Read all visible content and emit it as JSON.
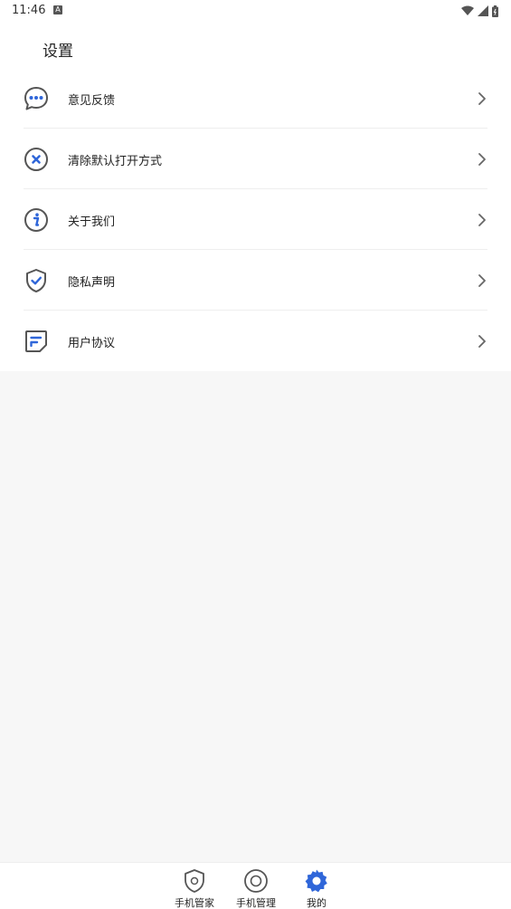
{
  "status_bar": {
    "time": "11:46",
    "indicator": "A"
  },
  "header": {
    "title": "设置"
  },
  "menu": {
    "items": [
      {
        "label": "意见反馈",
        "icon": "chat-bubble-icon"
      },
      {
        "label": "清除默认打开方式",
        "icon": "clear-x-icon"
      },
      {
        "label": "关于我们",
        "icon": "info-icon"
      },
      {
        "label": "隐私声明",
        "icon": "shield-check-icon"
      },
      {
        "label": "用户协议",
        "icon": "document-icon"
      }
    ]
  },
  "bottom_nav": {
    "tabs": [
      {
        "label": "手机管家",
        "icon": "shield-icon",
        "active": false
      },
      {
        "label": "手机管理",
        "icon": "circle-icon",
        "active": false
      },
      {
        "label": "我的",
        "icon": "gear-icon",
        "active": true
      }
    ]
  },
  "colors": {
    "accent": "#2f66d9",
    "icon_stroke": "#555555",
    "text": "#222222"
  }
}
